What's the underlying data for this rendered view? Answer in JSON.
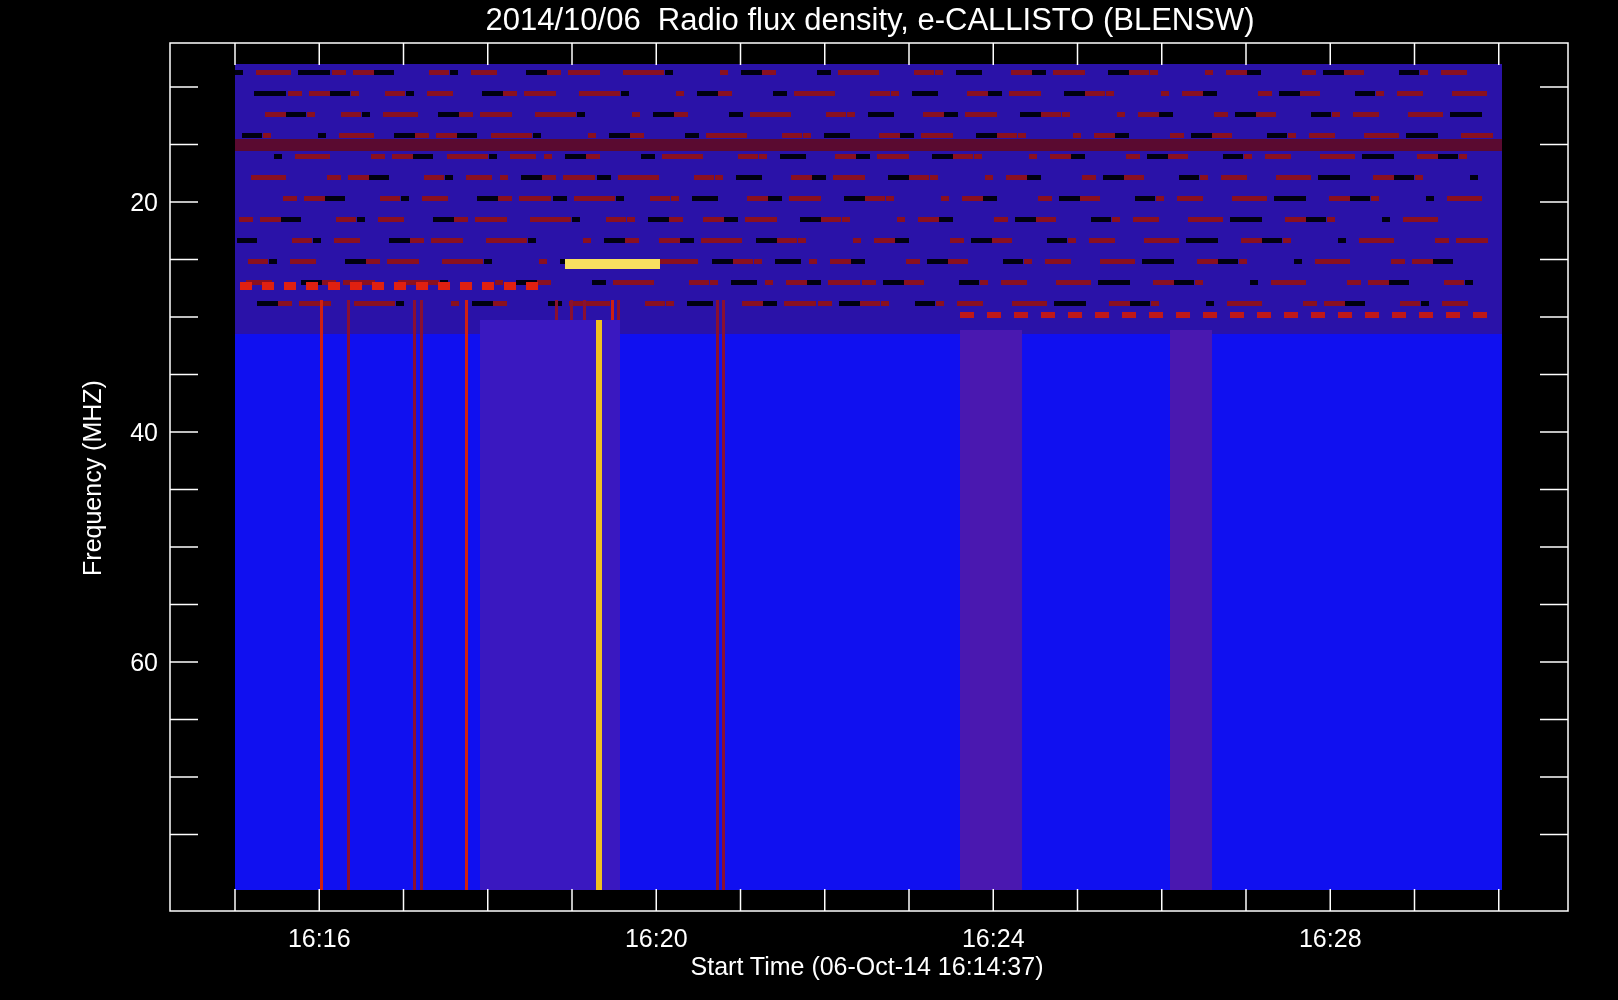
{
  "title": "2014/10/06  Radio flux density, e-CALLISTO (BLENSW)",
  "y_label": "Frequency (MHZ)",
  "y_ticks": [
    "20",
    "40",
    "60"
  ],
  "x_ticks": [
    "16:16",
    "16:20",
    "16:24",
    "16:28"
  ],
  "x_label": "Start Time (06-Oct-14 16:14:37)"
}
